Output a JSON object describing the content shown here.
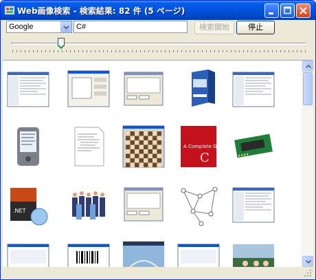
{
  "window": {
    "title": "Web画像検索 - 検索結果: 82 件 (5 ページ)",
    "controls": {
      "minimize": "_",
      "maximize": "□",
      "close": "×"
    }
  },
  "toolbar": {
    "engine_selected": "Google",
    "query_value": "C#",
    "search_button_label": "検索開始",
    "search_button_enabled": false,
    "stop_button_label": "停止"
  },
  "slider": {
    "level_fraction": 0.17
  },
  "results": {
    "thumbnails": [
      {
        "subject": "ide-screenshot"
      },
      {
        "subject": "form-designer-screenshot"
      },
      {
        "subject": "dialog-screenshot"
      },
      {
        "subject": "software-box"
      },
      {
        "subject": "ide-screenshot"
      },
      {
        "subject": "pda-device"
      },
      {
        "subject": "code-document"
      },
      {
        "subject": "chess-game-screenshot"
      },
      {
        "subject": "book-cover-red"
      },
      {
        "subject": "circuit-board"
      },
      {
        "subject": "dotnet-framework-box"
      },
      {
        "subject": "group-of-people"
      },
      {
        "subject": "dialog-screenshot"
      },
      {
        "subject": "network-graph"
      },
      {
        "subject": "ide-screenshot"
      },
      {
        "subject": "app-screenshot"
      },
      {
        "subject": "barcode-screenshot"
      },
      {
        "subject": "bridge-photo"
      },
      {
        "subject": "app-screenshot"
      },
      {
        "subject": "photo"
      }
    ]
  },
  "colors": {
    "titlebar": "#0054e3",
    "window_face": "#ece9d8",
    "input_border": "#7f9db9",
    "results_bg": "#ffffff"
  }
}
